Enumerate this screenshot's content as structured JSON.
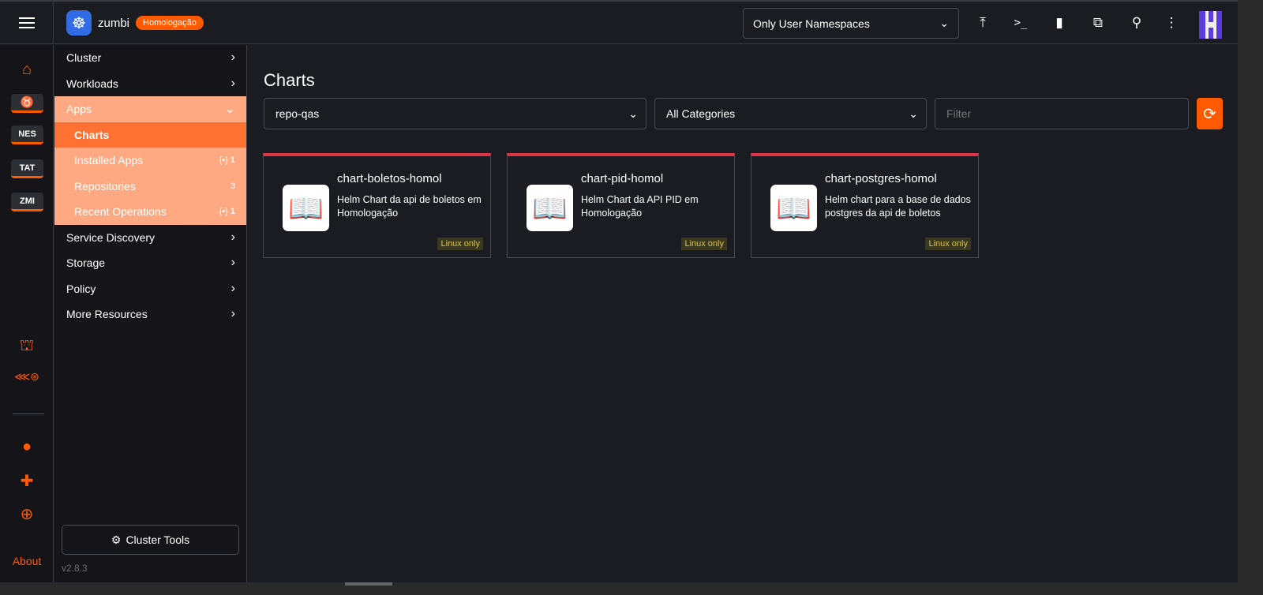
{
  "header": {
    "cluster_name": "zumbi",
    "env_badge": "Homologação",
    "namespace_filter": "Only User Namespaces"
  },
  "rail": {
    "tags": [
      "NES",
      "TAT",
      "ZMI"
    ],
    "about": "About"
  },
  "nav": {
    "items_top": [
      {
        "label": "Cluster"
      },
      {
        "label": "Workloads"
      }
    ],
    "apps": {
      "label": "Apps",
      "children": [
        {
          "label": "Charts",
          "count": ""
        },
        {
          "label": "Installed Apps",
          "count": "1"
        },
        {
          "label": "Repositories",
          "count": "3"
        },
        {
          "label": "Recent Operations",
          "count": "1"
        }
      ]
    },
    "items_bottom": [
      {
        "label": "Service Discovery"
      },
      {
        "label": "Storage"
      },
      {
        "label": "Policy"
      },
      {
        "label": "More Resources"
      }
    ],
    "cluster_tools": "Cluster Tools",
    "version": "v2.8.3"
  },
  "main": {
    "title": "Charts",
    "repo_select": "repo-qas",
    "category_select": "All Categories",
    "filter_placeholder": "Filter",
    "cards": [
      {
        "title": "chart-boletos-homol",
        "description": "Helm Chart da api de boletos em Homologação",
        "os": "Linux only"
      },
      {
        "title": "chart-pid-homol",
        "description": "Helm Chart da API PID em Homologação",
        "os": "Linux only"
      },
      {
        "title": "chart-postgres-homol",
        "description": "Helm chart para a base de dados postgres da api de boletos",
        "os": "Linux only"
      }
    ]
  },
  "colors": {
    "accent": "#ff5a00",
    "group_bg": "#ffa982",
    "active_bg": "#ff7033",
    "card_top": "#dc3545"
  }
}
